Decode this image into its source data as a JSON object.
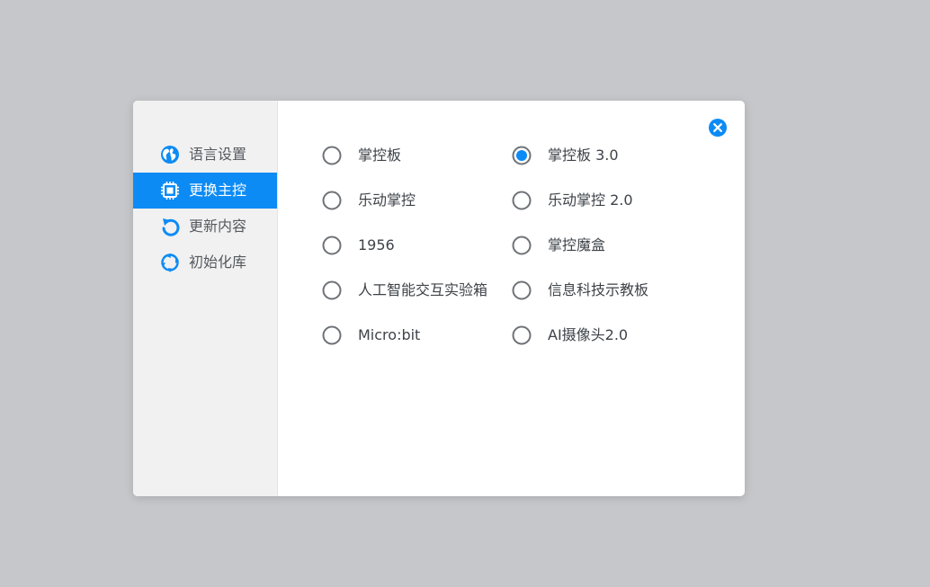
{
  "sidebar": {
    "items": [
      {
        "label": "语言设置",
        "icon": "globe-icon"
      },
      {
        "label": "更换主控",
        "icon": "chip-icon",
        "active": true
      },
      {
        "label": "更新内容",
        "icon": "refresh-icon"
      },
      {
        "label": "初始化库",
        "icon": "reset-icon"
      }
    ]
  },
  "options": {
    "col1": [
      {
        "label": "掌控板",
        "selected": false
      },
      {
        "label": "乐动掌控",
        "selected": false
      },
      {
        "label": "1956",
        "selected": false
      },
      {
        "label": "人工智能交互实验箱",
        "selected": false
      },
      {
        "label": "Micro:bit",
        "selected": false
      }
    ],
    "col2": [
      {
        "label": "掌控板 3.0",
        "selected": true
      },
      {
        "label": "乐动掌控 2.0",
        "selected": false
      },
      {
        "label": "掌控魔盒",
        "selected": false
      },
      {
        "label": "信息科技示教板",
        "selected": false
      },
      {
        "label": "AI摄像头2.0",
        "selected": false
      }
    ]
  },
  "colors": {
    "accent": "#0d8bf5",
    "backdrop": "#c6c7cb",
    "sidebar_bg": "#f1f1f1",
    "text": "#3e4349"
  },
  "close_icon": "close-circle-icon"
}
